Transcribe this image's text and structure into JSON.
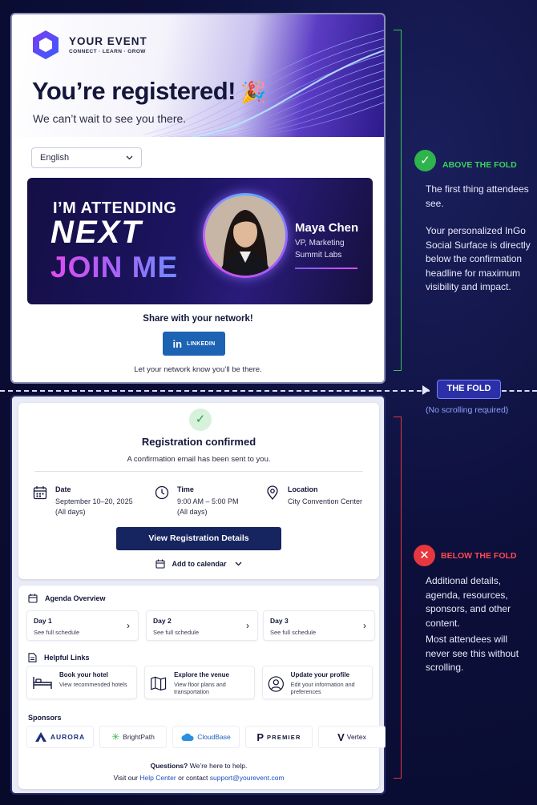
{
  "brand": {
    "name": "YOUR EVENT",
    "tagline": "CONNECT · LEARN · GROW"
  },
  "hero": {
    "title": "You’re registered!",
    "emoji": "🎉",
    "subtitle": "We can’t wait to see you there."
  },
  "language": {
    "selected": "English"
  },
  "banner": {
    "line1": "I’M ATTENDING",
    "line2": "NEXT",
    "line3": "JOIN ME",
    "person_name": "Maya Chen",
    "person_role": "VP, Marketing",
    "person_company": "Summit Labs"
  },
  "share": {
    "title": "Share with your network!",
    "linkedin_label": "LINKEDIN",
    "note": "Let your network know you’ll be there."
  },
  "fold": {
    "label": "THE FOLD",
    "note": "(No scrolling required)"
  },
  "annotations": {
    "above": {
      "title": "ABOVE THE FOLD",
      "p1": "The first thing attendees see.",
      "p2": "Your personalized InGo Social Surface is directly below the confirmation headline for maximum visibility and impact."
    },
    "below": {
      "title": "BELOW THE FOLD",
      "p1": "Additional details, agenda, resources, sponsors, and other content.",
      "p2": "Most attendees will never see this without scrolling."
    }
  },
  "confirm": {
    "title": "Registration confirmed",
    "subtitle": "A confirmation email has been sent to you.",
    "date_label": "Date",
    "date_value": "September 10–20, 2025",
    "date_note": "(All days)",
    "time_label": "Time",
    "time_value": "9:00 AM – 5:00 PM",
    "time_note": "(All days)",
    "location_label": "Location",
    "location_value": "City Convention Center",
    "view_button": "View Registration Details",
    "calendar_label": "Add to calendar"
  },
  "agenda": {
    "title": "Agenda Overview",
    "days": [
      {
        "label": "Day 1",
        "sub": "See full schedule"
      },
      {
        "label": "Day 2",
        "sub": "See full schedule"
      },
      {
        "label": "Day 3",
        "sub": "See full schedule"
      }
    ]
  },
  "helpful": {
    "title": "Helpful Links",
    "items": [
      {
        "title": "Book your hotel",
        "sub": "View recommended hotels"
      },
      {
        "title": "Explore the venue",
        "sub": "View floor plans and transportation"
      },
      {
        "title": "Update your profile",
        "sub": "Edit your information and preferences"
      }
    ]
  },
  "sponsors": {
    "title": "Sponsors",
    "names": [
      "AURORA",
      "BrightPath",
      "CloudBase",
      "PREMIER",
      "Vertex"
    ]
  },
  "footer": {
    "q_bold": "Questions?",
    "q_rest": " We’re here to help.",
    "visit": "Visit our ",
    "help_center": "Help Center",
    "or_contact": " or contact ",
    "email": "support@yourevent.com"
  },
  "colors": {
    "accent_navy": "#16245f",
    "linkedin": "#1d63b3",
    "green": "#3bd25e",
    "red": "#ff4a52",
    "fold_badge": "#2b2fa8"
  }
}
